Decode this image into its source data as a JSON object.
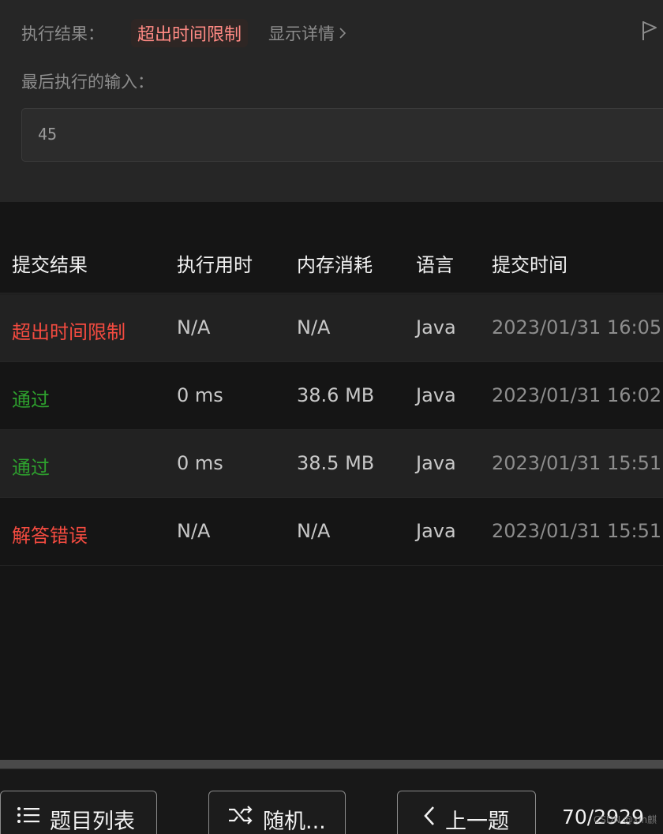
{
  "result": {
    "label": "执行结果：",
    "status": "超出时间限制",
    "details_link": "显示详情",
    "last_input_label": "最后执行的输入：",
    "last_input_value": "45"
  },
  "table": {
    "headers": [
      "提交结果",
      "执行用时",
      "内存消耗",
      "语言",
      "提交时间"
    ],
    "rows": [
      {
        "status": "超出时间限制",
        "status_color": "red",
        "time": "N/A",
        "memory": "N/A",
        "language": "Java",
        "submitted": "2023/01/31 16:05"
      },
      {
        "status": "通过",
        "status_color": "green",
        "time": "0 ms",
        "memory": "38.6 MB",
        "language": "Java",
        "submitted": "2023/01/31 16:02"
      },
      {
        "status": "通过",
        "status_color": "green",
        "time": "0 ms",
        "memory": "38.5 MB",
        "language": "Java",
        "submitted": "2023/01/31 15:51"
      },
      {
        "status": "解答错误",
        "status_color": "red",
        "time": "N/A",
        "memory": "N/A",
        "language": "Java",
        "submitted": "2023/01/31 15:51"
      }
    ]
  },
  "bottom": {
    "problem_list_label": "题目列表",
    "random_label": "随机...",
    "prev_label": "上一题",
    "counter": "70/2929",
    "watermark": "CSDN @xin麒"
  },
  "colors": {
    "error": "#f44b40",
    "success": "#2ea12e",
    "badge_text": "#ff8a84"
  },
  "icons": [
    "flag-icon",
    "chevron-right-icon",
    "list-icon",
    "shuffle-icon",
    "chevron-left-icon"
  ]
}
